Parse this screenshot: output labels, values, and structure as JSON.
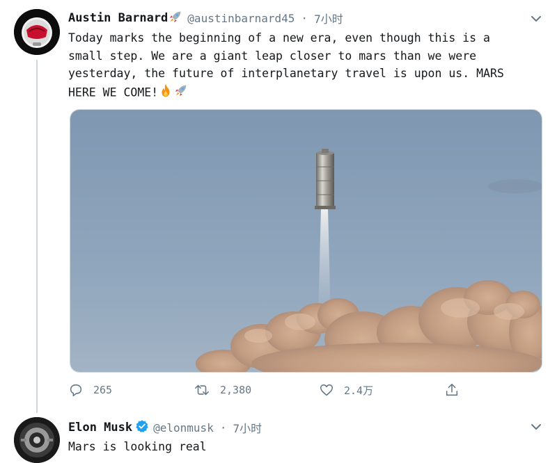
{
  "tweets": [
    {
      "display_name": "Austin Barnard",
      "handle": "@austinbarnard45",
      "separator": "·",
      "time": "7小时",
      "text": "Today marks the beginning of a new era, even though this is a\nsmall step. We are a giant leap closer to mars than we were\nyesterday, the future of interplanetary travel is upon us. MARS\nHERE WE COME!",
      "name_emoji": "rocket-icon",
      "text_emojis": [
        "fire-icon",
        "rocket-icon"
      ],
      "media": "starship-hop-photo",
      "actions": {
        "reply_count": "265",
        "retweet_count": "2,380",
        "like_count": "2.4万",
        "share_label": ""
      }
    },
    {
      "display_name": "Elon Musk",
      "verified": true,
      "handle": "@elonmusk",
      "separator": "·",
      "time": "7小时",
      "text": "Mars is looking real"
    }
  ],
  "colors": {
    "text": "#14171a",
    "secondary": "#657786",
    "verified": "#1da1f2",
    "divider": "#ccd6dd"
  }
}
